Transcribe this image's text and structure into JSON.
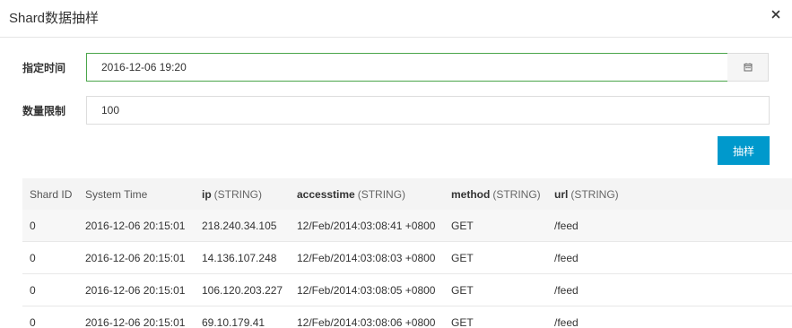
{
  "dialog": {
    "title": "Shard数据抽样"
  },
  "form": {
    "time_label": "指定时间",
    "time_value": "2016-12-06 19:20",
    "limit_label": "数量限制",
    "limit_value": "100",
    "sample_button": "抽样"
  },
  "table": {
    "headers": [
      {
        "name": "Shard ID",
        "type": ""
      },
      {
        "name": "System Time",
        "type": ""
      },
      {
        "name": "ip",
        "type": "(STRING)"
      },
      {
        "name": "accesstime",
        "type": "(STRING)"
      },
      {
        "name": "method",
        "type": "(STRING)"
      },
      {
        "name": "url",
        "type": "(STRING)"
      }
    ],
    "rows": [
      [
        "0",
        "2016-12-06 20:15:01",
        "218.240.34.105",
        "12/Feb/2014:03:08:41 +0800",
        "GET",
        "/feed"
      ],
      [
        "0",
        "2016-12-06 20:15:01",
        "14.136.107.248",
        "12/Feb/2014:03:08:03 +0800",
        "GET",
        "/feed"
      ],
      [
        "0",
        "2016-12-06 20:15:01",
        "106.120.203.227",
        "12/Feb/2014:03:08:05 +0800",
        "GET",
        "/feed"
      ],
      [
        "0",
        "2016-12-06 20:15:01",
        "69.10.179.41",
        "12/Feb/2014:03:08:06 +0800",
        "GET",
        "/feed"
      ]
    ]
  },
  "colors": {
    "accent": "#0099cc",
    "focus_border": "#4aa54a"
  },
  "icons": {
    "close": "close-icon",
    "calendar": "calendar-icon"
  }
}
